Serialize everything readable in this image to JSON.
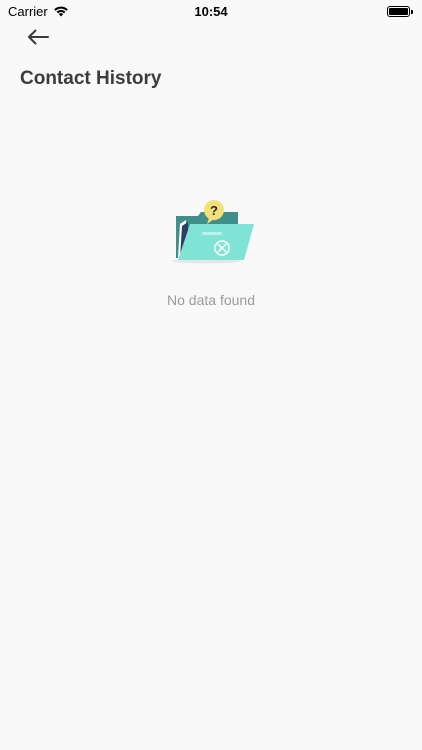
{
  "status_bar": {
    "carrier": "Carrier",
    "time": "10:54"
  },
  "header": {
    "title": "Contact History"
  },
  "empty_state": {
    "message": "No data found"
  },
  "icons": {
    "back": "arrow-left-icon",
    "illustration": "empty-folder-icon"
  },
  "colors": {
    "background": "#f9f9f9",
    "title": "#3c3c3c",
    "muted_text": "#9a9a9a",
    "folder_teal": "#7fe3d6",
    "folder_dark_teal": "#3f8f8a",
    "question_yellow": "#f4e07a"
  }
}
